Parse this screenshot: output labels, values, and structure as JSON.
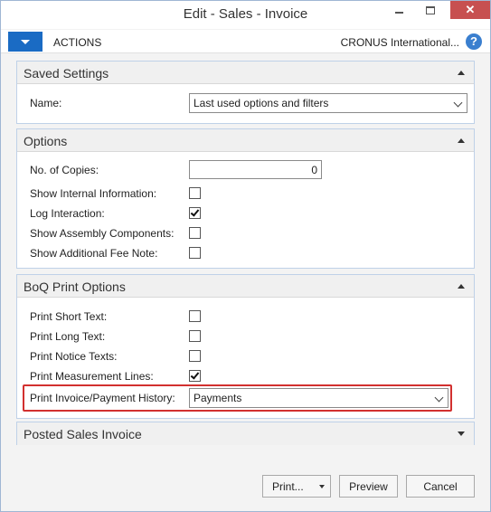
{
  "window": {
    "title": "Edit - Sales - Invoice",
    "close_glyph": "✕"
  },
  "actionbar": {
    "actions_label": "ACTIONS",
    "company": "CRONUS International...",
    "help_glyph": "?"
  },
  "saved_settings": {
    "title": "Saved Settings",
    "name_label": "Name:",
    "name_value": "Last used options and filters"
  },
  "options": {
    "title": "Options",
    "copies_label": "No. of Copies:",
    "copies_value": "0",
    "show_internal_label": "Show Internal Information:",
    "show_internal_checked": false,
    "log_interaction_label": "Log Interaction:",
    "log_interaction_checked": true,
    "show_assembly_label": "Show Assembly Components:",
    "show_assembly_checked": false,
    "show_fee_label": "Show Additional Fee Note:",
    "show_fee_checked": false
  },
  "boq": {
    "title": "BoQ Print Options",
    "short_text_label": "Print Short Text:",
    "short_text_checked": false,
    "long_text_label": "Print Long Text:",
    "long_text_checked": false,
    "notice_label": "Print Notice Texts:",
    "notice_checked": false,
    "measurement_label": "Print Measurement Lines:",
    "measurement_checked": true,
    "history_label": "Print Invoice/Payment History:",
    "history_value": "Payments"
  },
  "posted": {
    "title": "Posted Sales Invoice"
  },
  "footer": {
    "print_label": "Print...",
    "preview_label": "Preview",
    "cancel_label": "Cancel"
  },
  "colors": {
    "accent": "#1a6bc4",
    "highlight": "#d2302f",
    "close_button": "#c75050"
  }
}
